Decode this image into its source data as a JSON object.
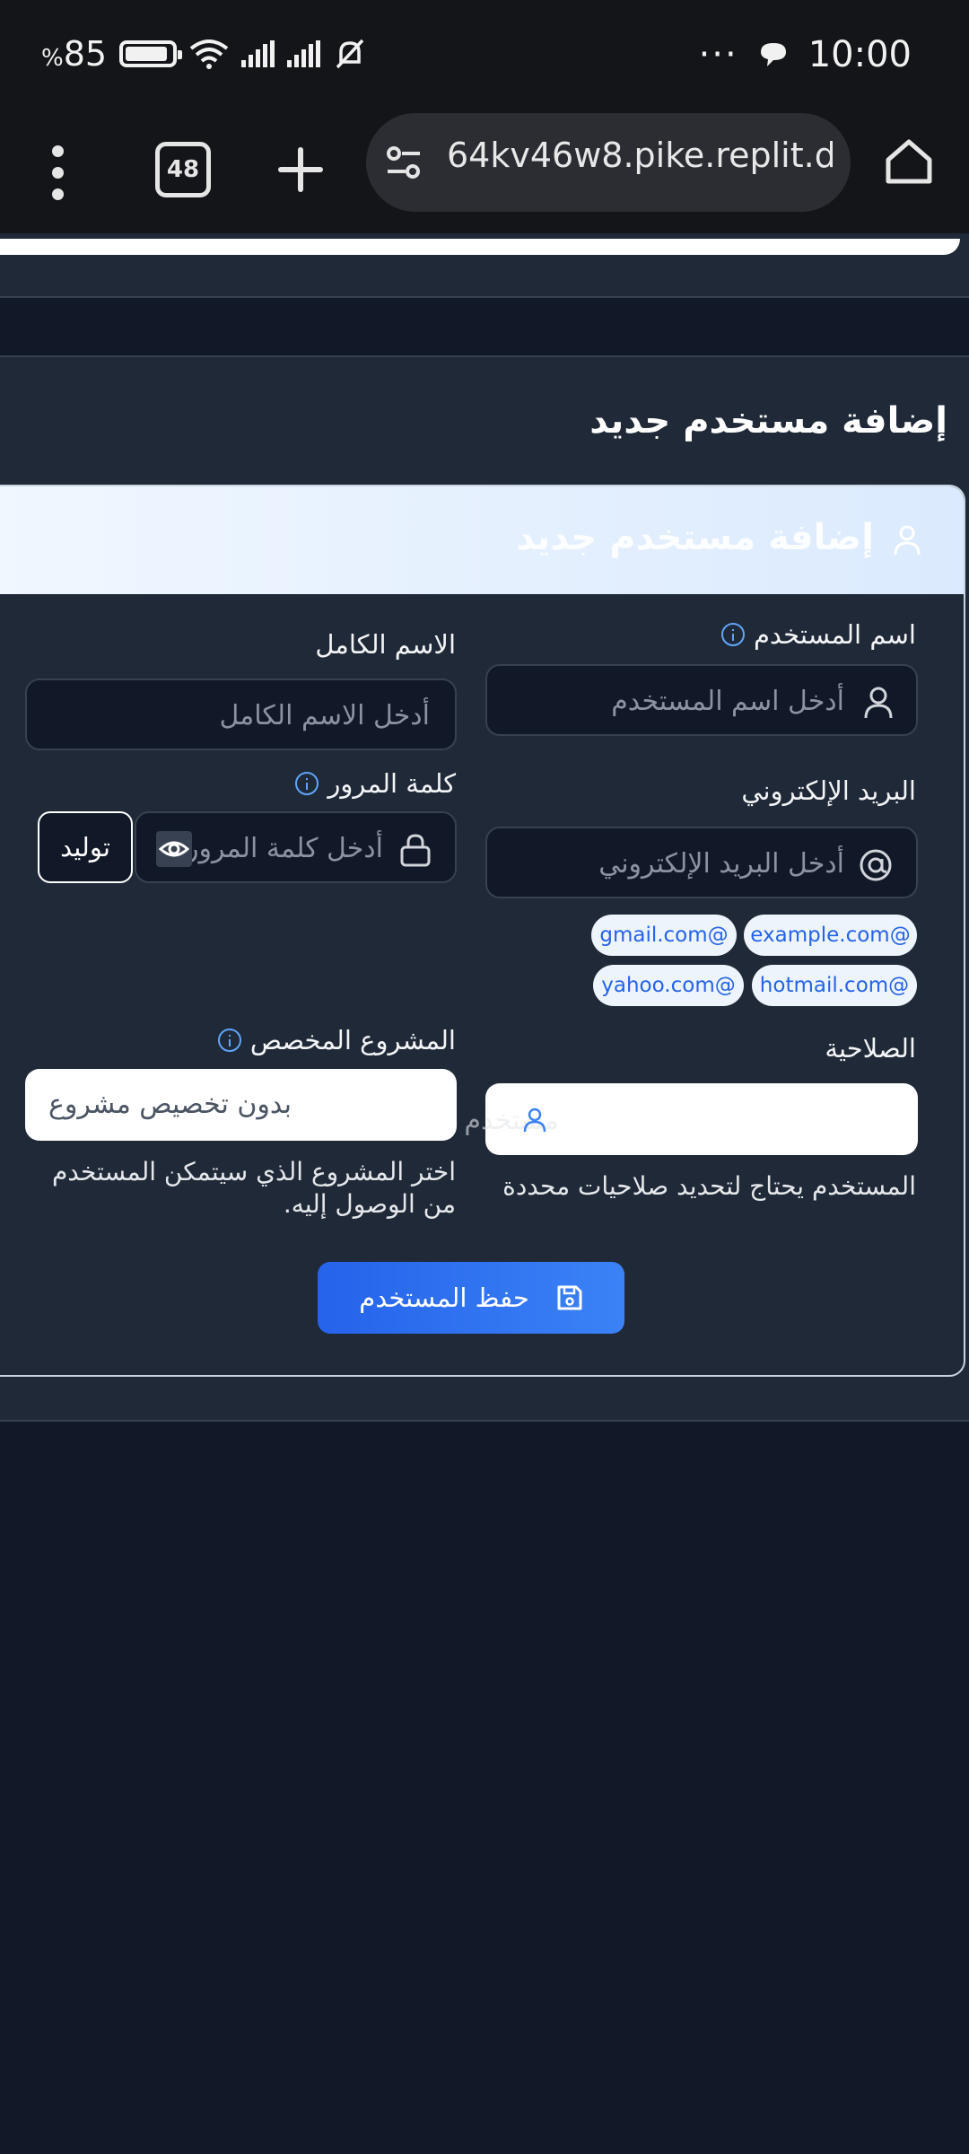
{
  "status_bar": {
    "battery": "85",
    "battery_suffix": "%",
    "time": "10:00"
  },
  "browser": {
    "tab_count": "48",
    "url": "64kv46w8.pike.replit.dev"
  },
  "page": {
    "title": "إضافة مستخدم جديد"
  },
  "card": {
    "header_title": "إضافة مستخدم جديد"
  },
  "form": {
    "username": {
      "label": "اسم المستخدم",
      "placeholder": "أدخل اسم المستخدم"
    },
    "fullname": {
      "label": "الاسم الكامل",
      "placeholder": "أدخل الاسم الكامل"
    },
    "email": {
      "label": "البريد الإلكتروني",
      "placeholder": "أدخل البريد الإلكتروني",
      "domains": [
        "example.com@",
        "gmail.com@",
        "hotmail.com@",
        "yahoo.com@"
      ]
    },
    "password": {
      "label": "كلمة المرور",
      "placeholder": "أدخل كلمة المرور",
      "generate_label": "توليد"
    },
    "role": {
      "label": "الصلاحية",
      "value": "مستخدم",
      "help": "المستخدم يحتاج لتحديد صلاحيات محددة"
    },
    "project": {
      "label": "المشروع المخصص",
      "value": "بدون تخصيص مشروع",
      "help": "اختر المشروع الذي سيتمكن المستخدم من الوصول إليه."
    },
    "save_label": "حفظ المستخدم"
  }
}
